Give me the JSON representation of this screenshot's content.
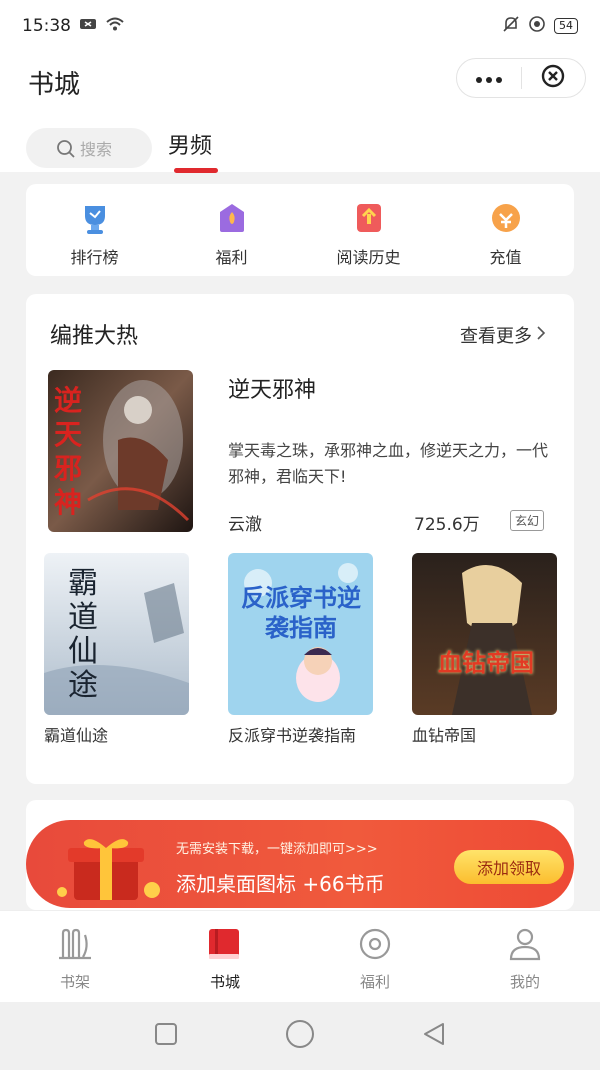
{
  "status_bar": {
    "time": "15:38",
    "battery": "54"
  },
  "header": {
    "title": "书城",
    "search_placeholder": "搜索",
    "tab_label": "男频"
  },
  "quick_nav": [
    {
      "label": "排行榜",
      "icon": "trophy-icon",
      "color": "#4a8fe0"
    },
    {
      "label": "福利",
      "icon": "gift-box-icon",
      "color": "#9b6be0"
    },
    {
      "label": "阅读历史",
      "icon": "history-icon",
      "color": "#ef5b5b"
    },
    {
      "label": "充值",
      "icon": "coin-icon",
      "color": "#f7a24a"
    }
  ],
  "recommend": {
    "title": "编推大热",
    "more_label": "查看更多",
    "featured": {
      "cover_text": "逆天邪神",
      "title": "逆天邪神",
      "description": "掌天毒之珠，承邪神之血，修逆天之力，一代邪神，君临天下!",
      "author": "云澈",
      "count": "725.6万",
      "tag": "玄幻"
    },
    "books": [
      {
        "title": "霸道仙途",
        "cover_text": "霸道仙途"
      },
      {
        "title": "反派穿书逆袭指南",
        "cover_text": "反派穿书逆袭指南"
      },
      {
        "title": "血钻帝国",
        "cover_text": "血钻帝国"
      }
    ]
  },
  "banner": {
    "sub_text": "无需安装下载，一键添加即可>>>",
    "main_text": "添加桌面图标 +66书币",
    "button_label": "添加领取"
  },
  "tabbar": [
    {
      "label": "书架",
      "icon": "bookshelf-icon"
    },
    {
      "label": "书城",
      "icon": "bookstore-icon"
    },
    {
      "label": "福利",
      "icon": "welfare-icon"
    },
    {
      "label": "我的",
      "icon": "profile-icon"
    }
  ],
  "colors": {
    "accent": "#e0292e"
  }
}
